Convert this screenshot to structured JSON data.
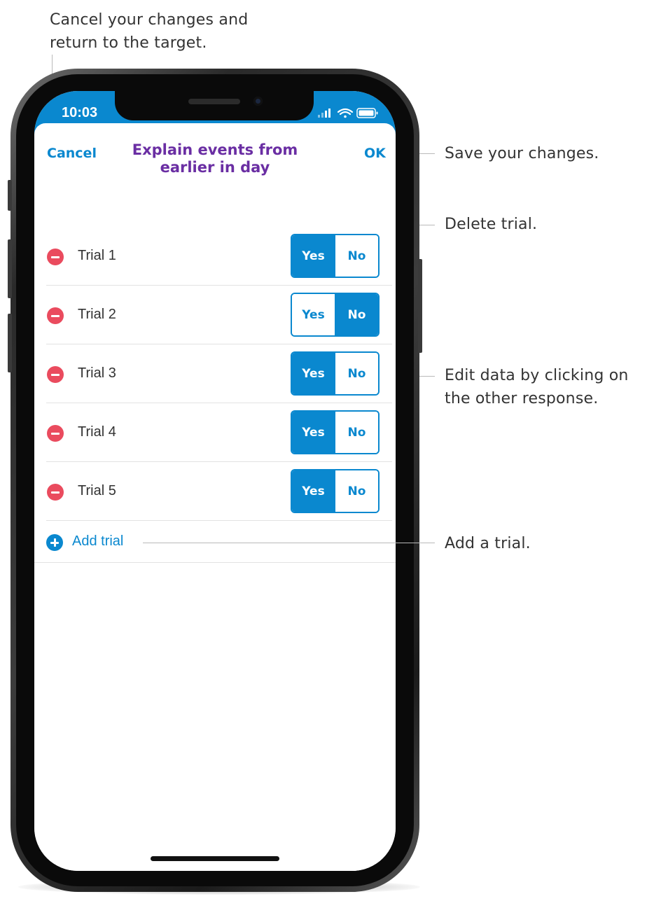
{
  "callouts": {
    "cancel": "Cancel your changes and return to the target.",
    "save": "Save your changes.",
    "delete": "Delete trial.",
    "edit": "Edit data by clicking on the other response.",
    "add": "Add a trial."
  },
  "status_bar": {
    "time": "10:03"
  },
  "nav": {
    "cancel_label": "Cancel",
    "title": "Explain events from earlier in day",
    "ok_label": "OK"
  },
  "trials": [
    {
      "label": "Trial 1",
      "yes": "Yes",
      "no": "No",
      "selected": "Yes"
    },
    {
      "label": "Trial 2",
      "yes": "Yes",
      "no": "No",
      "selected": "No"
    },
    {
      "label": "Trial 3",
      "yes": "Yes",
      "no": "No",
      "selected": "Yes"
    },
    {
      "label": "Trial 4",
      "yes": "Yes",
      "no": "No",
      "selected": "Yes"
    },
    {
      "label": "Trial 5",
      "yes": "Yes",
      "no": "No",
      "selected": "Yes"
    }
  ],
  "add_trial": {
    "label": "Add trial"
  },
  "colors": {
    "accent": "#0a88cf",
    "title": "#6a2ea3",
    "delete": "#ea4b5e"
  },
  "icons": [
    "remove-circle-icon",
    "add-circle-icon",
    "signal-icon",
    "wifi-icon",
    "battery-icon"
  ]
}
